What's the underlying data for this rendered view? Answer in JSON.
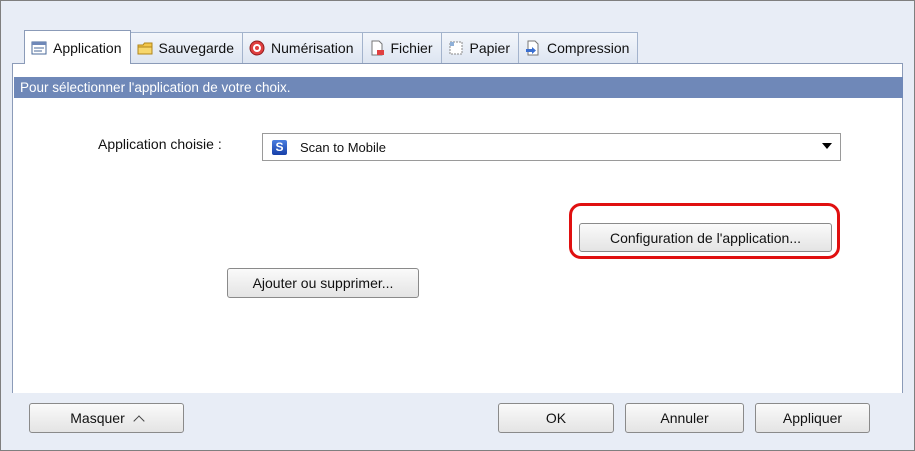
{
  "tabs": [
    {
      "label": "Application",
      "icon": "application-icon",
      "active": true
    },
    {
      "label": "Sauvegarde",
      "icon": "folder-icon",
      "active": false
    },
    {
      "label": "Numérisation",
      "icon": "scan-icon",
      "active": false
    },
    {
      "label": "Fichier",
      "icon": "file-icon",
      "active": false
    },
    {
      "label": "Papier",
      "icon": "paper-icon",
      "active": false
    },
    {
      "label": "Compression",
      "icon": "compression-icon",
      "active": false
    }
  ],
  "banner": "Pour sélectionner l'application de votre choix.",
  "app_select": {
    "label": "Application choisie :",
    "value": "Scan to Mobile",
    "icon": "scan-to-mobile-icon"
  },
  "buttons": {
    "config": "Configuration de l'application...",
    "add_remove": "Ajouter ou supprimer...",
    "hide": "Masquer",
    "ok": "OK",
    "cancel": "Annuler",
    "apply": "Appliquer"
  },
  "colors": {
    "banner": "#6f88b8",
    "highlight": "#e01010",
    "window_bg": "#e8edf6"
  }
}
